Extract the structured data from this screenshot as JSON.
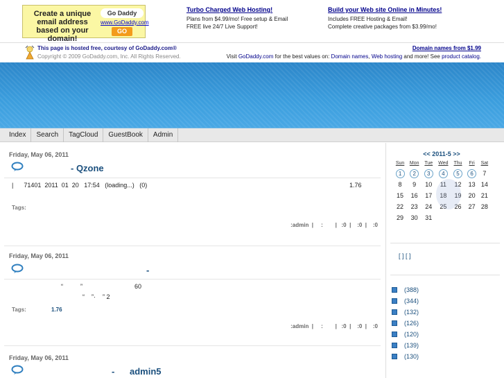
{
  "ad_bar": {
    "banner": {
      "text": "Create a unique email address based on your domain!",
      "logo": "Go Daddy",
      "url": "www.GoDaddy.com",
      "button": "GO"
    },
    "promo1": {
      "title": "Turbo Charged Web Hosting!",
      "line1": "Plans from $4.99/mo! Free setup & Email",
      "line2": "FREE live 24/7 Live Support!"
    },
    "promo2": {
      "title": "Build your Web site Online in Minutes!",
      "line1": "Includes FREE Hosting & Email!",
      "line2": "Complete creative packages from $3.99/mo!"
    }
  },
  "host_bar": {
    "line1_prefix": "This page is hosted free, courtesy of ",
    "line1_link": "GoDaddy.com",
    "line1_suffix": "®",
    "copyright": "Copyright © 2009 GoDaddy.com, Inc. All Rights Reserved.",
    "domain_link": "Domain names from $1.99",
    "visit_prefix": "Visit ",
    "visit_link": "GoDaddy.com",
    "visit_mid": " for the best values on: ",
    "link_domains": "Domain names",
    "sep": ", ",
    "link_hosting": "Web hosting",
    "visit_more": " and more! See ",
    "link_catalog": "product catalog."
  },
  "nav": {
    "items": [
      "Index",
      "Search",
      "TagCloud",
      "GuestBook",
      "Admin"
    ]
  },
  "posts": [
    {
      "date": "Friday, May 06, 2011",
      "title": "- Qzone",
      "body_left": "|      71401  2011  01  20   17:54   (loading...)   (0)",
      "body_right": "1.76",
      "tags_label": "Tags:",
      "tags_value": "",
      "meta": ":admin  |     :        |   :0  |    :0  |    :0"
    },
    {
      "date": "Friday, May 06, 2011",
      "title": "-",
      "body_line1": "“          ”                              60",
      "body_line2": "“    ”·    ” 2",
      "tags_label": "Tags:",
      "tags_value": "1.76",
      "meta": ":admin  |     :        |   :0  |    :0  |    :0"
    },
    {
      "date": "Friday, May 06, 2011",
      "title": "-      admin5"
    }
  ],
  "calendar": {
    "header": "<< 2011-5 >>",
    "days": [
      "Sun",
      "Mon",
      "Tue",
      "Wed",
      "Thu",
      "Fri",
      "Sat"
    ],
    "weeks": [
      [
        "1",
        "2",
        "3",
        "4",
        "5",
        "6",
        "7"
      ],
      [
        "8",
        "9",
        "10",
        "11",
        "12",
        "13",
        "14"
      ],
      [
        "15",
        "16",
        "17",
        "18",
        "19",
        "20",
        "21"
      ],
      [
        "22",
        "23",
        "24",
        "25",
        "26",
        "27",
        "28"
      ],
      [
        "29",
        "30",
        "31",
        "",
        "",
        "",
        ""
      ]
    ],
    "linked_days": [
      "1",
      "2",
      "3",
      "4",
      "5",
      "6"
    ]
  },
  "sidebar": {
    "links": "[  ] [  ]",
    "categories": [
      "(388)",
      "(344)",
      "(132)",
      "(126)",
      "(120)",
      "(139)",
      "(130)"
    ]
  },
  "colors": {
    "header_blue": "#3b9ede",
    "link_blue": "#1a4f7d",
    "banner_yellow": "#fbf7a4"
  }
}
